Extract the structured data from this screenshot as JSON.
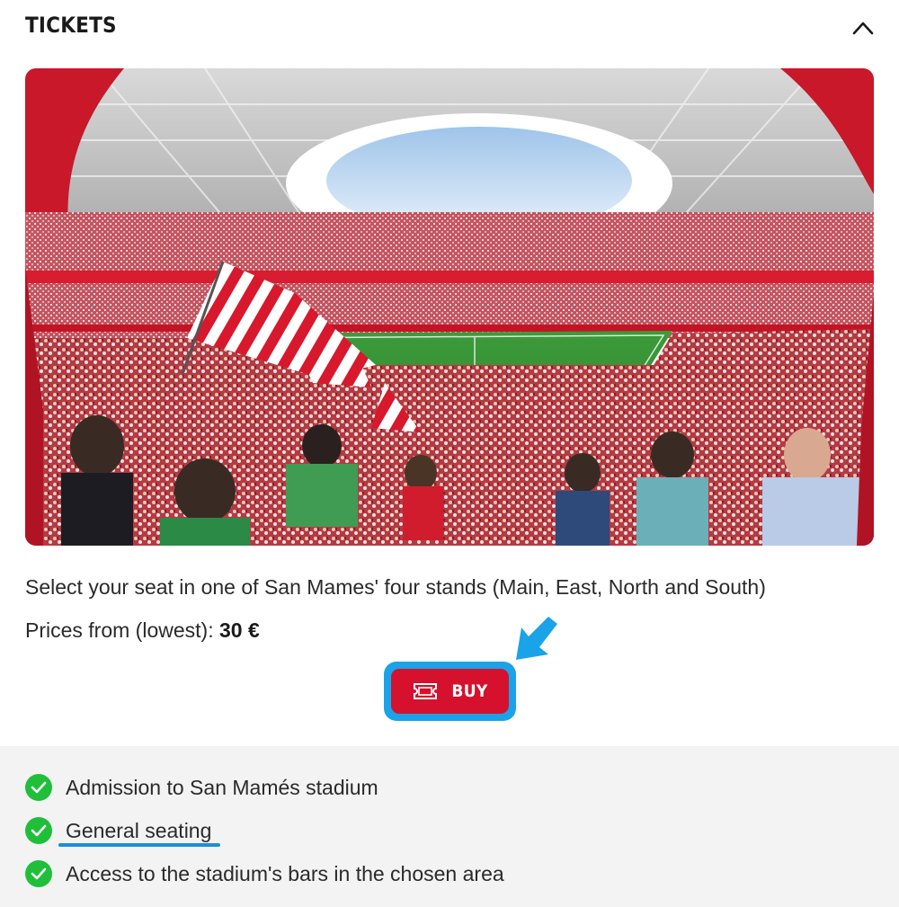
{
  "header": {
    "title": "TICKETS",
    "collapse_icon": "chevron-up-icon"
  },
  "hero": {
    "image": "stadium-photo"
  },
  "description": "Select your seat in one of San Mames' four stands (Main, East, North and South)",
  "price": {
    "label": "Prices from (lowest): ",
    "value": "30 €"
  },
  "buy_button": {
    "label": "BUY",
    "icon": "ticket-icon",
    "color": "#d6112e",
    "highlight_color": "#1aa3e8"
  },
  "pointer_arrow": "arrow-down-left-icon",
  "features": [
    {
      "label": "Admission to San Mamés stadium"
    },
    {
      "label": "General seating"
    },
    {
      "label": "Access to the stadium's bars in the chosen area"
    }
  ],
  "colors": {
    "check": "#1fbf3a",
    "features_bg": "#f3f3f3"
  }
}
